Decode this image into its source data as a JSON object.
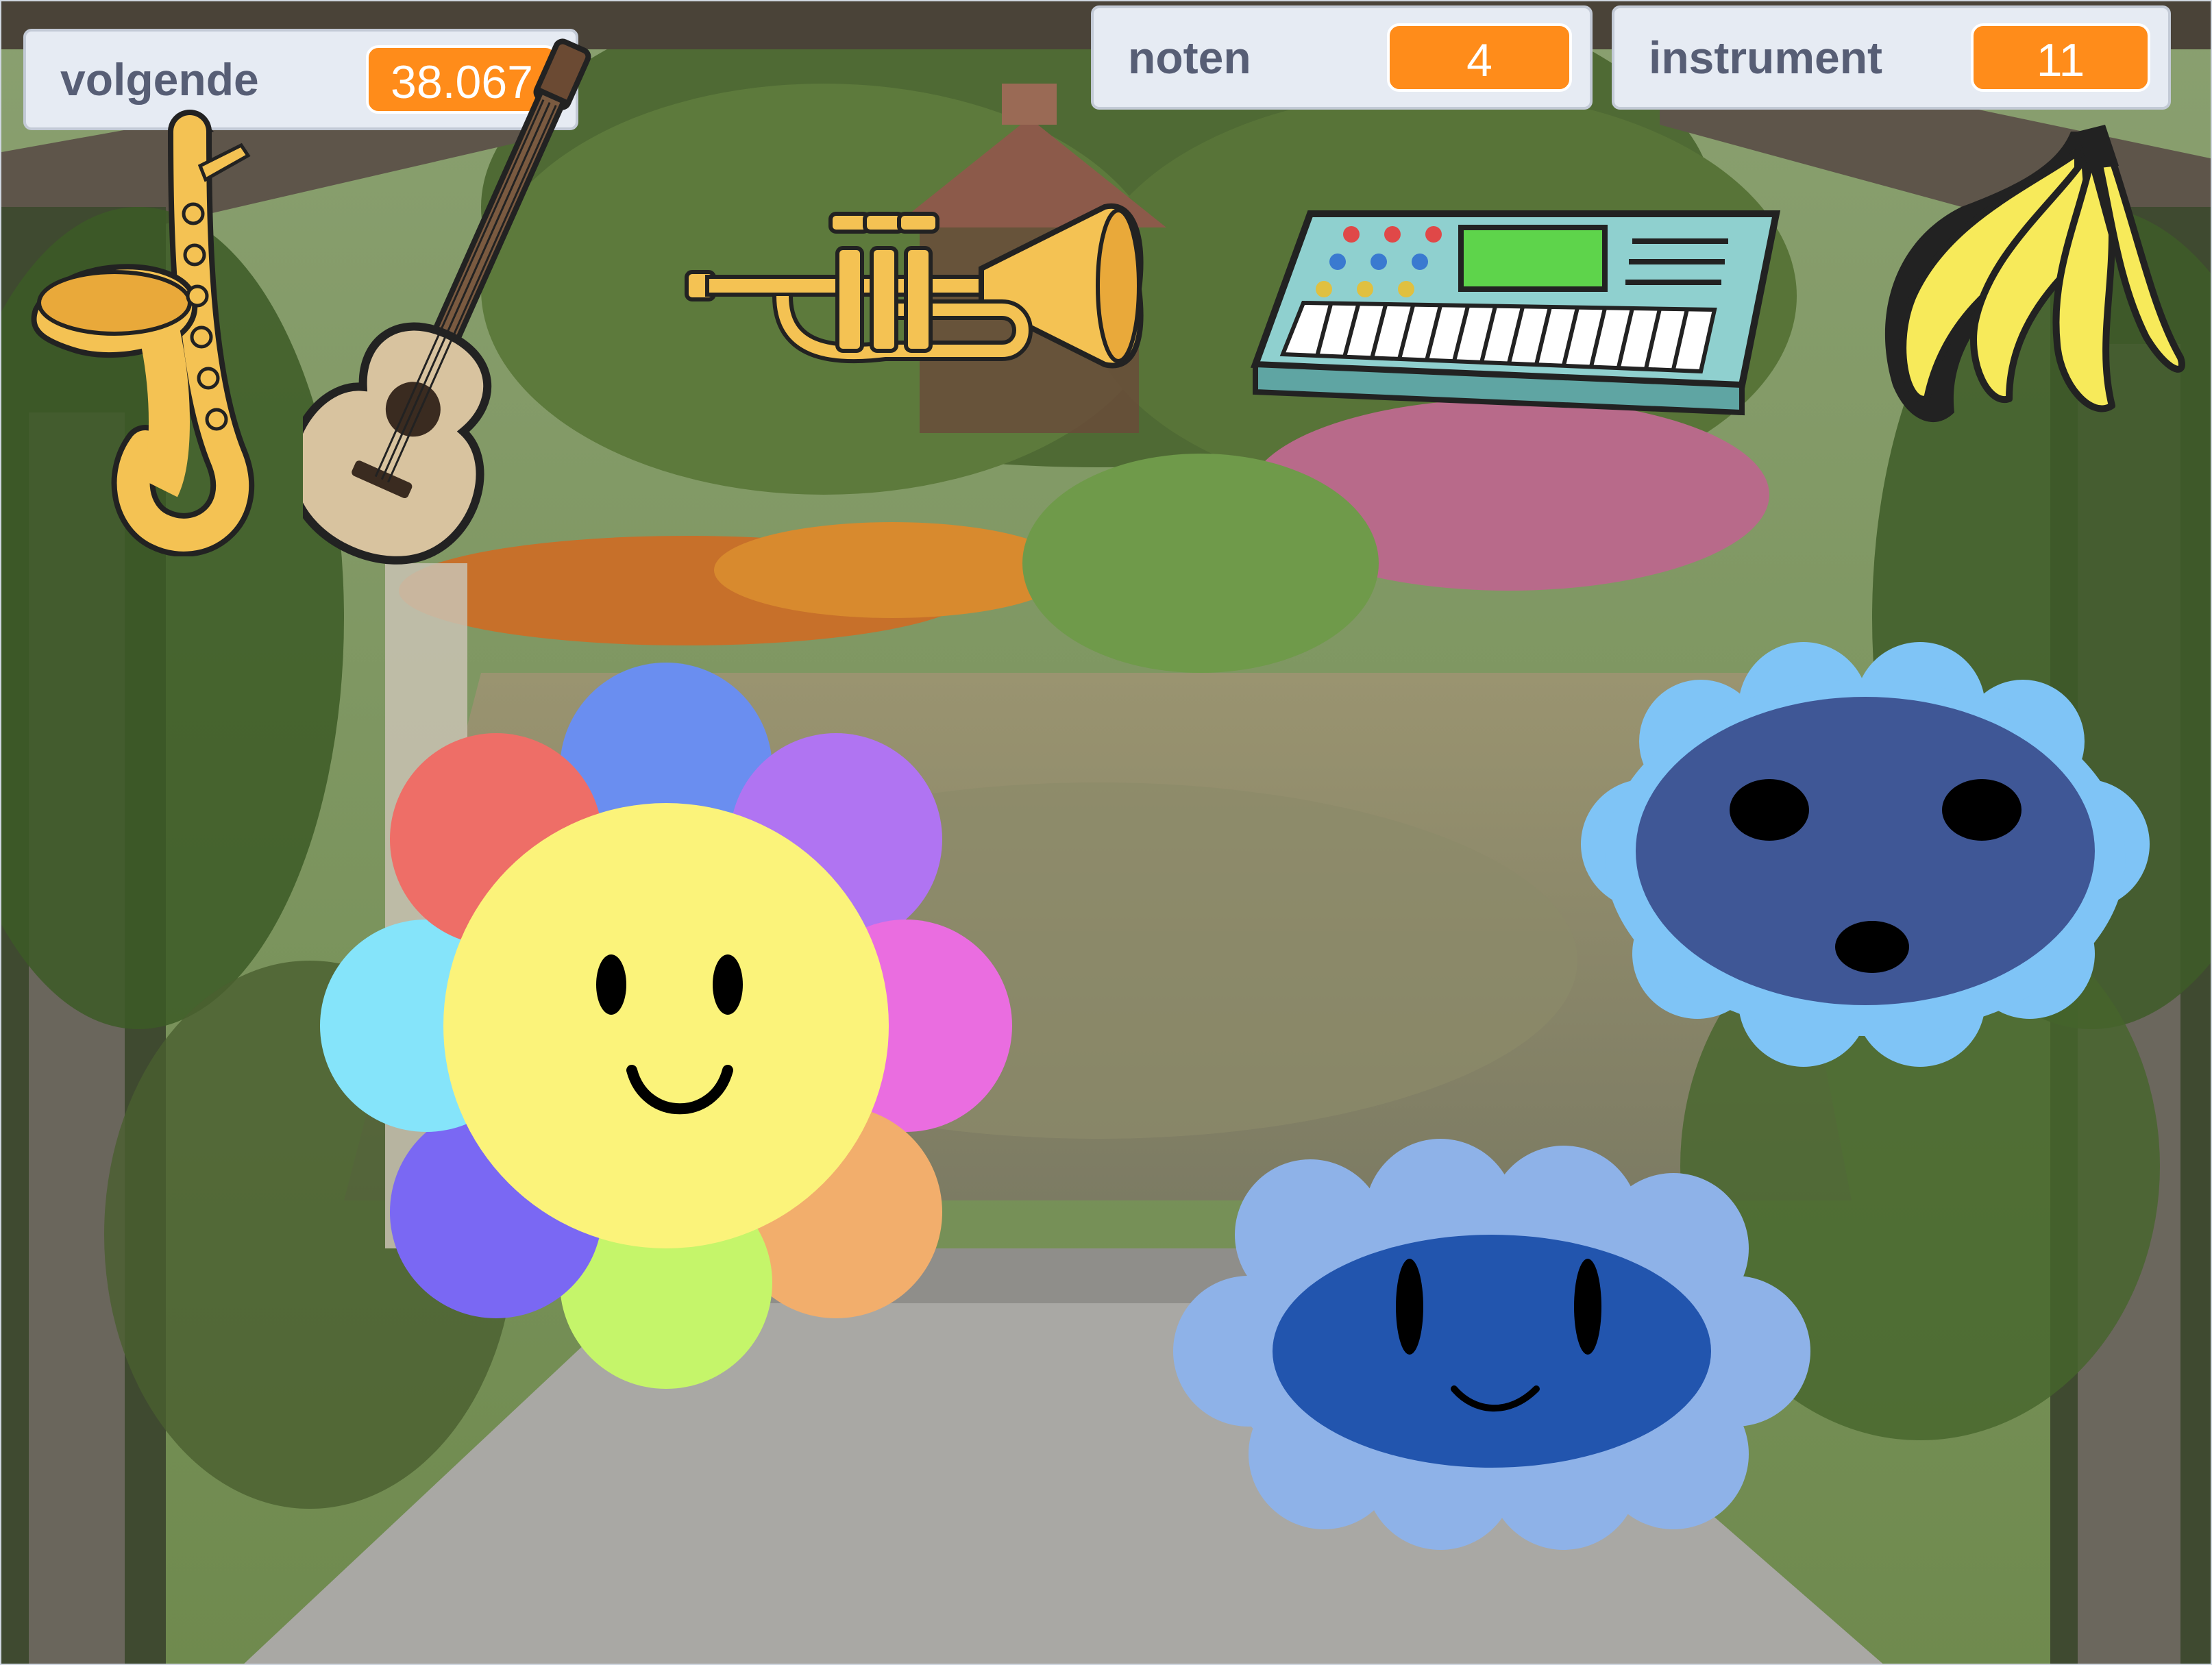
{
  "monitors": [
    {
      "label": "volgende",
      "value": "38.067"
    },
    {
      "label": "noten",
      "value": "4"
    },
    {
      "label": "instrument",
      "value": "11"
    }
  ],
  "colors": {
    "monitor_value_bg": "#ff8c1a",
    "monitor_label": "#575e75",
    "monitor_bg": "#e6ebf3"
  },
  "sprites": [
    {
      "name": "saxophone-icon"
    },
    {
      "name": "guitar-icon"
    },
    {
      "name": "trumpet-icon"
    },
    {
      "name": "keyboard-icon"
    },
    {
      "name": "banana-icon"
    },
    {
      "name": "rainbow-flower"
    },
    {
      "name": "dark-blue-cloud"
    },
    {
      "name": "light-blue-cloud"
    }
  ]
}
